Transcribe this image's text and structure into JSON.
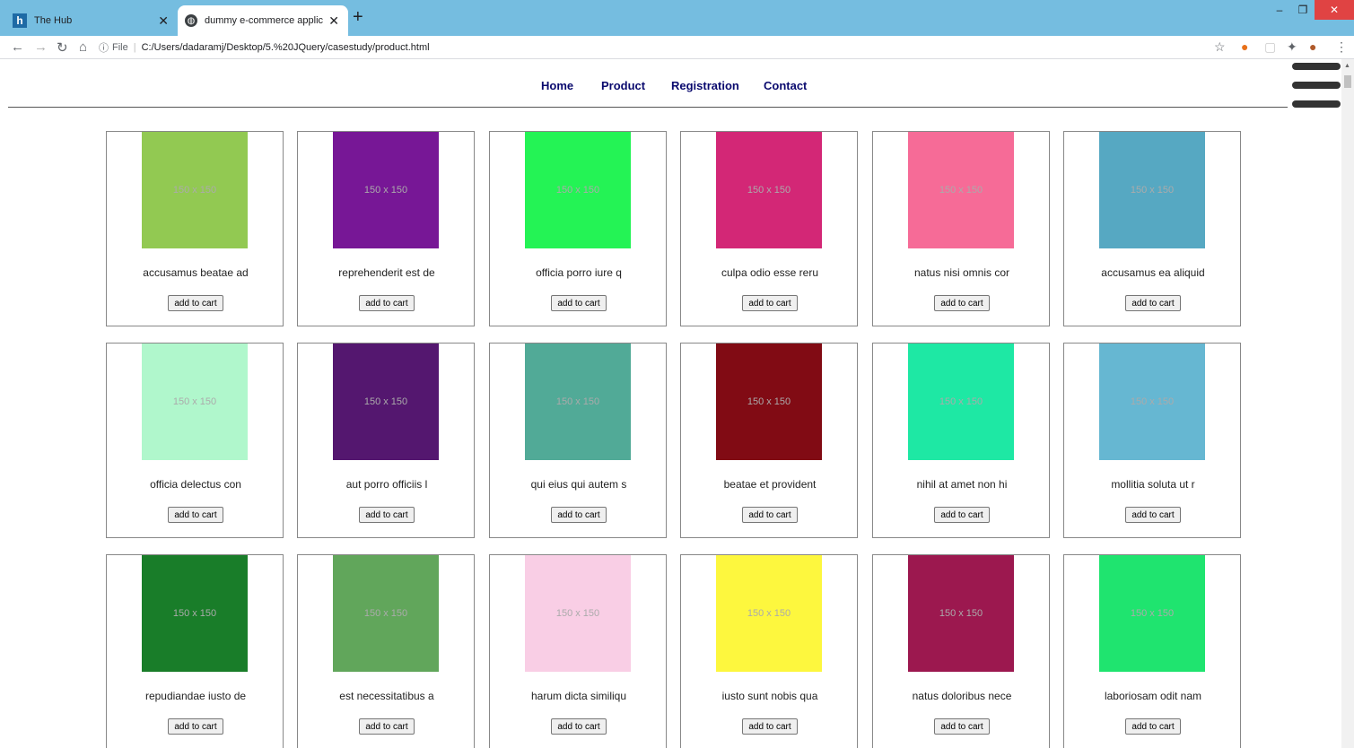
{
  "browser": {
    "tabs": [
      {
        "title": "The Hub",
        "active": false,
        "favicon": "h-logo-icon"
      },
      {
        "title": "dummy e-commerce application",
        "active": true,
        "favicon": "globe-icon"
      }
    ],
    "omnibox": {
      "info": "ⓘ",
      "scheme_label": "File",
      "separator": "|",
      "url": "C:/Users/dadaramj/Desktop/5.%20JQuery/casestudy/product.html"
    }
  },
  "nav": {
    "links": [
      "Home",
      "Product",
      "Registration",
      "Contact"
    ]
  },
  "products": [
    {
      "name": "accusamus beatae ad",
      "color": "#92c952",
      "placeholder": "150 x 150",
      "button": "add to cart"
    },
    {
      "name": "reprehenderit est de",
      "color": "#771796",
      "placeholder": "150 x 150",
      "button": "add to cart"
    },
    {
      "name": "officia porro iure q",
      "color": "#24f355",
      "placeholder": "150 x 150",
      "button": "add to cart"
    },
    {
      "name": "culpa odio esse reru",
      "color": "#d32776",
      "placeholder": "150 x 150",
      "button": "add to cart"
    },
    {
      "name": "natus nisi omnis cor",
      "color": "#f66b97",
      "placeholder": "150 x 150",
      "button": "add to cart"
    },
    {
      "name": "accusamus ea aliquid",
      "color": "#56a8c2",
      "placeholder": "150 x 150",
      "button": "add to cart"
    },
    {
      "name": "officia delectus con",
      "color": "#b0f7cc",
      "placeholder": "150 x 150",
      "button": "add to cart"
    },
    {
      "name": "aut porro officiis l",
      "color": "#54176f",
      "placeholder": "150 x 150",
      "button": "add to cart"
    },
    {
      "name": "qui eius qui autem s",
      "color": "#51aa97",
      "placeholder": "150 x 150",
      "button": "add to cart"
    },
    {
      "name": "beatae et provident",
      "color": "#810b14",
      "placeholder": "150 x 150",
      "button": "add to cart"
    },
    {
      "name": "nihil at amet non hi",
      "color": "#1ee8a4",
      "placeholder": "150 x 150",
      "button": "add to cart"
    },
    {
      "name": "mollitia soluta ut r",
      "color": "#66b7d2",
      "placeholder": "150 x 150",
      "button": "add to cart"
    },
    {
      "name": "repudiandae iusto de",
      "color": "#197d29",
      "placeholder": "150 x 150",
      "button": "add to cart"
    },
    {
      "name": "est necessitatibus a",
      "color": "#61a65",
      "placeholder": "150 x 150",
      "button": "add to cart"
    },
    {
      "name": "harum dicta similiqu",
      "color": "#f9cee5",
      "placeholder": "150 x 150",
      "button": "add to cart"
    },
    {
      "name": "iusto sunt nobis qua",
      "color": "#fdf73e",
      "placeholder": "150 x 150",
      "button": "add to cart"
    },
    {
      "name": "natus doloribus nece",
      "color": "#9c184f",
      "placeholder": "150 x 150",
      "button": "add to cart"
    },
    {
      "name": "laboriosam odit nam",
      "color": "#1fe46f",
      "placeholder": "150 x 150",
      "button": "add to cart"
    }
  ]
}
